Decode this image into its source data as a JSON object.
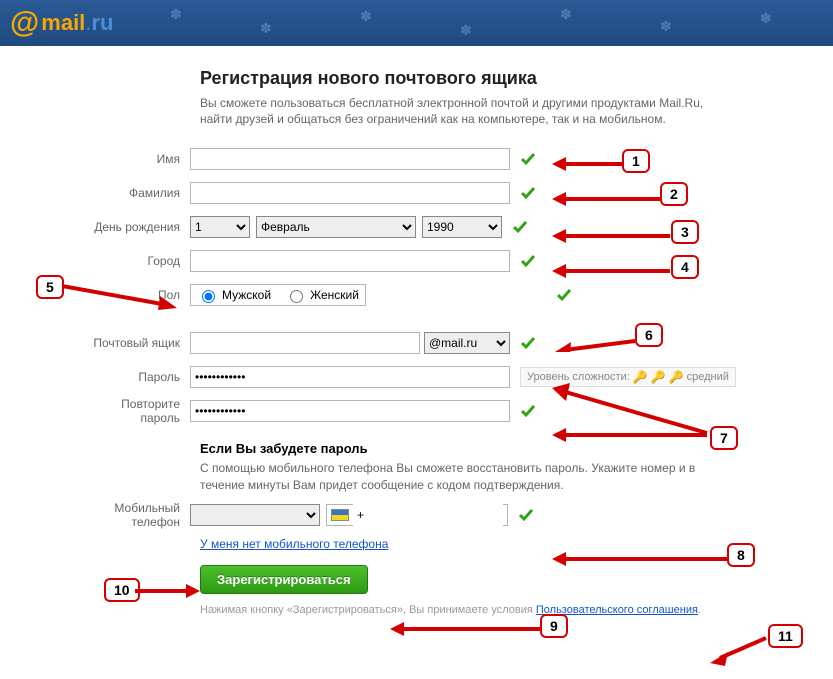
{
  "logo": {
    "at": "@",
    "mail": "mail",
    "dot": ".",
    "ru": "ru"
  },
  "title": "Регистрация нового почтового ящика",
  "intro": "Вы сможете пользоваться бесплатной электронной почтой и другими продуктами Mail.Ru, найти друзей и общаться без ограничений как на компьютере, так и на мобильном.",
  "labels": {
    "name": "Имя",
    "surname": "Фамилия",
    "birthday": "День рождения",
    "city": "Город",
    "gender": "Пол",
    "mailbox": "Почтовый ящик",
    "password": "Пароль",
    "password2": "Повторите пароль",
    "mobile": "Мобильный телефон"
  },
  "values": {
    "name": "",
    "surname": "",
    "day": "1",
    "month": "Февраль",
    "year": "1990",
    "city": "",
    "gender_male": "Мужской",
    "gender_female": "Женский",
    "mailbox": "",
    "domain": "@mail.ru",
    "password": "••••••••••••",
    "password2": "••••••••••••",
    "country": "",
    "phone": "+"
  },
  "password_meter": {
    "label": "Уровень сложности:",
    "level": "средний"
  },
  "recovery": {
    "title": "Если Вы забудете пароль",
    "text": "С помощью мобильного телефона Вы сможете восстановить пароль. Укажите номер и в течение минуты Вам придет сообщение с кодом подтверждения."
  },
  "no_phone_link": "У меня нет мобильного телефона",
  "register_btn": "Зарегистрироваться",
  "agreement": {
    "prefix": "Нажимая кнопку «Зарегистрироваться», Вы принимаете условия ",
    "link": "Пользовательского соглашения",
    "suffix": "."
  },
  "callouts": {
    "1": "1",
    "2": "2",
    "3": "3",
    "4": "4",
    "5": "5",
    "6": "6",
    "7": "7",
    "8": "8",
    "9": "9",
    "10": "10",
    "11": "11"
  }
}
